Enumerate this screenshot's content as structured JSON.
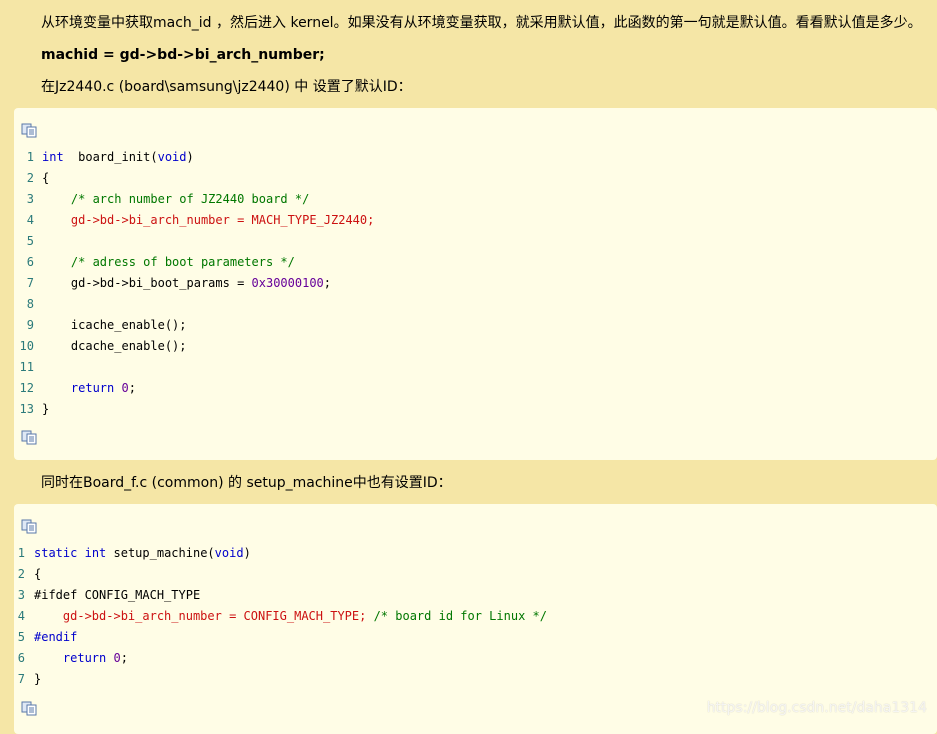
{
  "paragraphs": {
    "p1": "从环境变量中获取mach_id ，然后进入 kernel。如果没有从环境变量获取，就采用默认值，此函数的第一句就是默认值。看看默认值是多少。",
    "p2": "machid = gd->bd->bi_arch_number;",
    "p3": "在Jz2440.c (board\\samsung\\jz2440) 中 设置了默认ID：",
    "p4": "同时在Board_f.c (common) 的 setup_machine中也有设置ID："
  },
  "code1": {
    "lines": [
      {
        "n": "1",
        "parts": [
          [
            "kw",
            "int"
          ],
          [
            "",
            "  board_init("
          ],
          [
            "kw",
            "void"
          ],
          [
            "",
            ")"
          ]
        ]
      },
      {
        "n": "2",
        "parts": [
          [
            "",
            "{"
          ]
        ]
      },
      {
        "n": "3",
        "parts": [
          [
            "",
            "    "
          ],
          [
            "cm",
            "/* arch number of JZ2440 board */"
          ]
        ]
      },
      {
        "n": "4",
        "parts": [
          [
            "",
            "    "
          ],
          [
            "red",
            "gd->bd->bi_arch_number = MACH_TYPE_JZ2440;"
          ]
        ]
      },
      {
        "n": "5",
        "parts": []
      },
      {
        "n": "6",
        "parts": [
          [
            "",
            "    "
          ],
          [
            "cm",
            "/* adress of boot parameters */"
          ]
        ]
      },
      {
        "n": "7",
        "parts": [
          [
            "",
            "    gd->bd->bi_boot_params = "
          ],
          [
            "num",
            "0x30000100"
          ],
          [
            "",
            ";"
          ]
        ]
      },
      {
        "n": "8",
        "parts": []
      },
      {
        "n": "9",
        "parts": [
          [
            "",
            "    icache_enable();"
          ]
        ]
      },
      {
        "n": "10",
        "parts": [
          [
            "",
            "    dcache_enable();"
          ]
        ]
      },
      {
        "n": "11",
        "parts": []
      },
      {
        "n": "12",
        "parts": [
          [
            "",
            "    "
          ],
          [
            "kw",
            "return"
          ],
          [
            "",
            " "
          ],
          [
            "num",
            "0"
          ],
          [
            "",
            ";"
          ]
        ]
      },
      {
        "n": "13",
        "parts": [
          [
            "",
            "}"
          ]
        ]
      }
    ]
  },
  "code2": {
    "lines": [
      {
        "n": "1",
        "parts": [
          [
            "kw",
            "static"
          ],
          [
            "",
            " "
          ],
          [
            "kw",
            "int"
          ],
          [
            "",
            " setup_machine("
          ],
          [
            "kw",
            "void"
          ],
          [
            "",
            ")"
          ]
        ]
      },
      {
        "n": "2",
        "parts": [
          [
            "",
            "{"
          ]
        ]
      },
      {
        "n": "3",
        "parts": [
          [
            "",
            "#ifdef CONFIG_MACH_TYPE"
          ]
        ]
      },
      {
        "n": "4",
        "parts": [
          [
            "",
            "    "
          ],
          [
            "red",
            "gd->bd->bi_arch_number = CONFIG_MACH_TYPE;"
          ],
          [
            "",
            " "
          ],
          [
            "cm",
            "/* board id for Linux */"
          ]
        ]
      },
      {
        "n": "5",
        "parts": [
          [
            "pp",
            "#endif"
          ]
        ]
      },
      {
        "n": "6",
        "parts": [
          [
            "",
            "    "
          ],
          [
            "kw",
            "return"
          ],
          [
            "",
            " "
          ],
          [
            "num",
            "0"
          ],
          [
            "",
            ";"
          ]
        ]
      },
      {
        "n": "7",
        "parts": [
          [
            "",
            "}"
          ]
        ]
      }
    ]
  },
  "watermark": "https://blog.csdn.net/daha1314",
  "icons": {
    "copy": "copy-code-icon"
  }
}
